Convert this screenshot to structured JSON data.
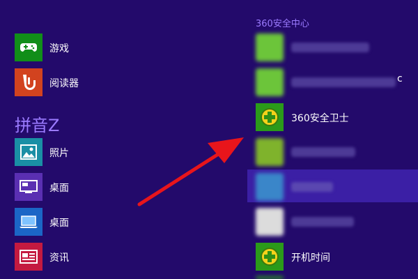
{
  "left_column": {
    "items": [
      {
        "label": "游戏",
        "tile_color": "#118e19",
        "icon": "gamepad-icon"
      },
      {
        "label": "阅读器",
        "tile_color": "#d2431f",
        "icon": "reader-icon"
      }
    ],
    "group_header": "拼音Z",
    "group_items": [
      {
        "label": "照片",
        "tile_color": "#1a8fa5",
        "icon": "photo-icon"
      },
      {
        "label": "桌面",
        "tile_color": "#5a2fb2",
        "icon": "desktop-icon"
      },
      {
        "label": "桌面",
        "tile_color": "#1b66c6",
        "icon": "laptop-icon"
      },
      {
        "label": "资讯",
        "tile_color": "#c41a40",
        "icon": "news-icon"
      }
    ]
  },
  "right_column": {
    "header": "360安全中心",
    "items": [
      {
        "label": "360安全卫士",
        "tile_color": "#2b9a1a",
        "icon": "360-plus-icon"
      },
      {
        "label": "开机时间",
        "tile_color": "#2b9a1a",
        "icon": "360-plus-icon"
      }
    ],
    "partial_text": "c"
  },
  "colors": {
    "background": "#230a6b",
    "accent_text": "#9b7bff",
    "arrow": "#e8151b",
    "highlight_row": "#3b1fa5"
  }
}
